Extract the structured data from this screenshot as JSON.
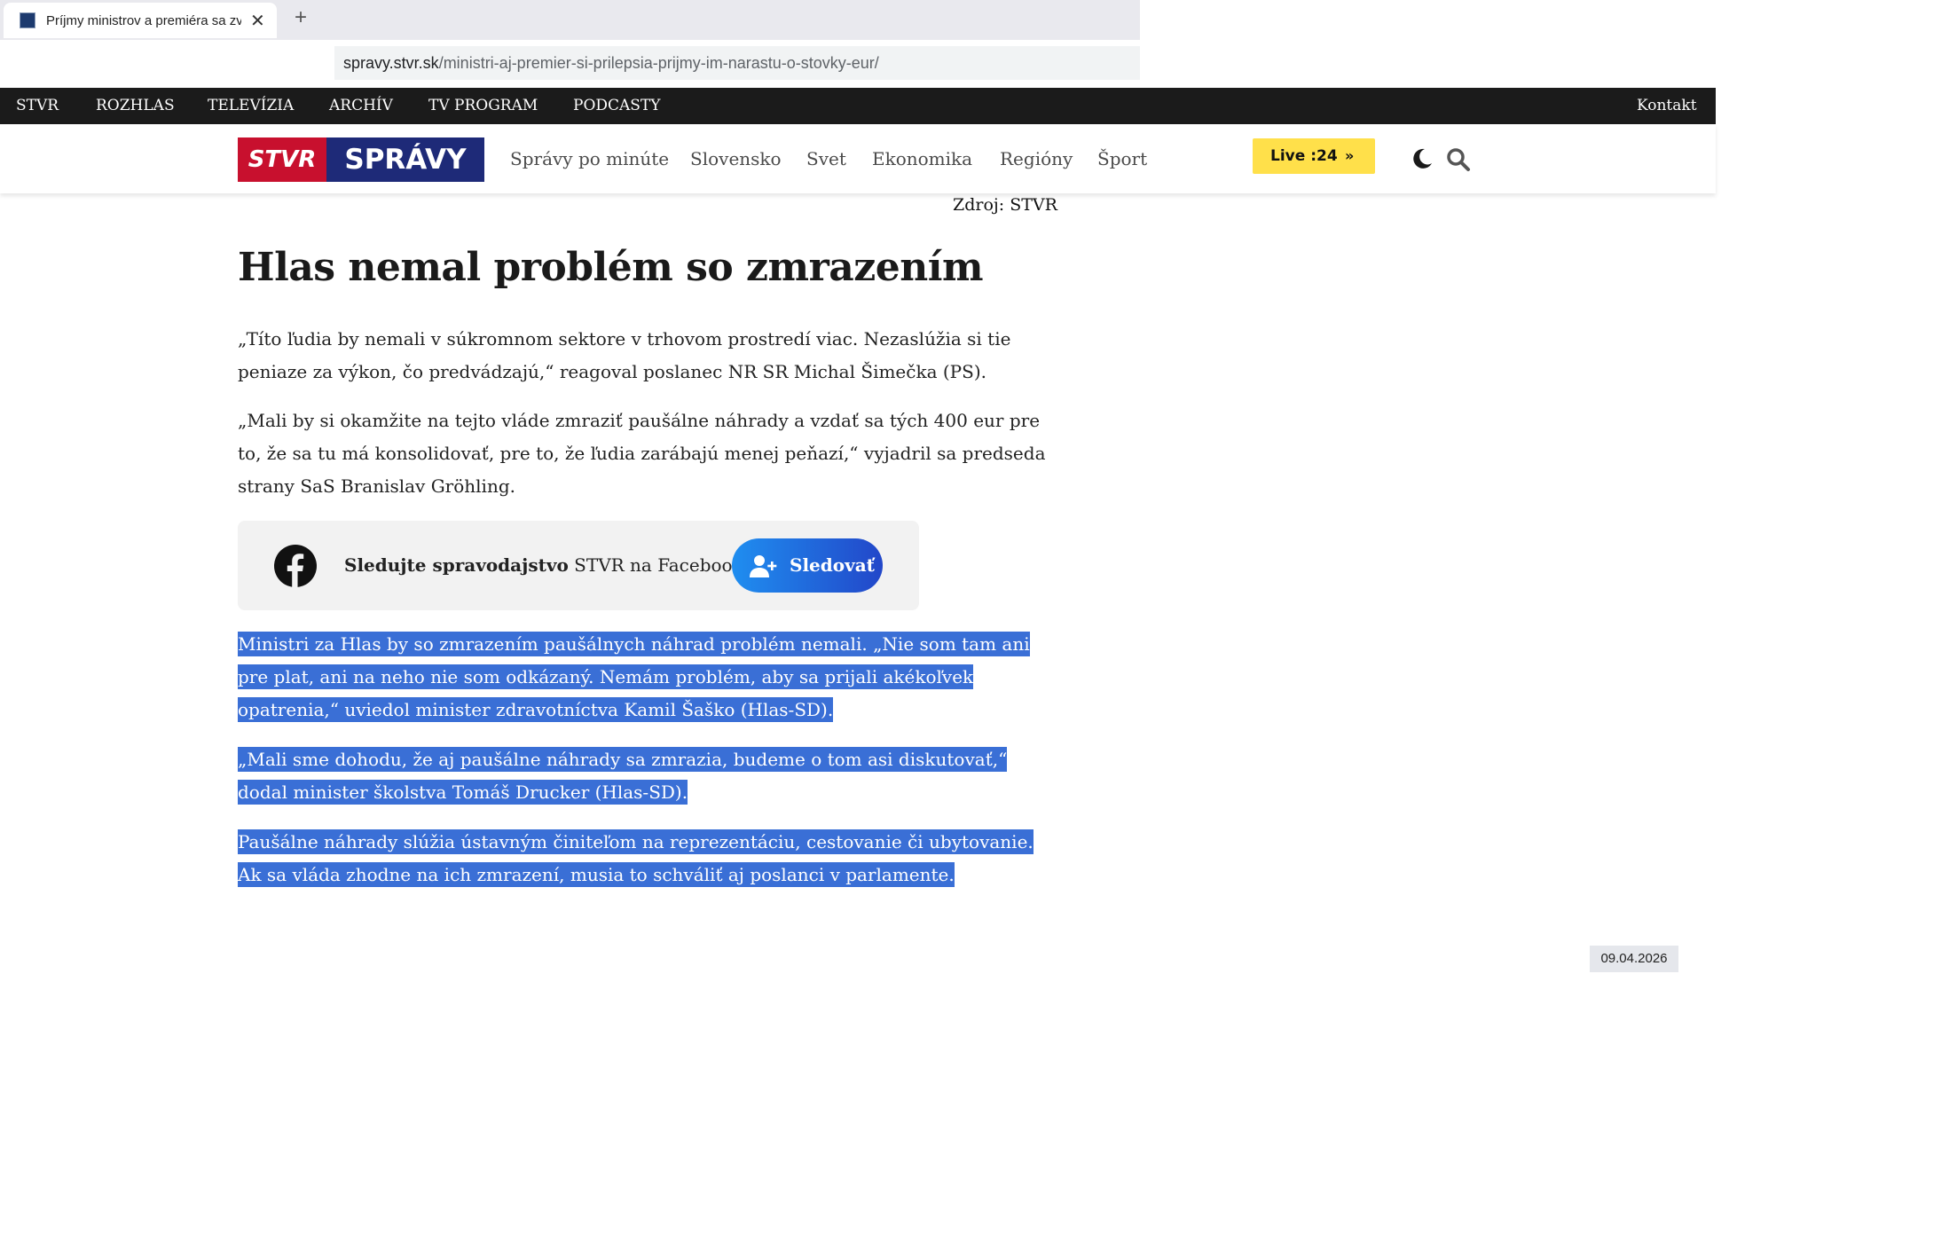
{
  "browser": {
    "tab_title": "Príjmy ministrov a premiéra sa zvýšia",
    "close_symbol": "✕",
    "new_tab_symbol": "+",
    "url_host": "spravy.stvr.sk",
    "url_path": "/ministri-aj-premier-si-prilepsia-prijmy-im-narastu-o-stovky-eur/"
  },
  "topbar": {
    "items": [
      "STVR",
      "ROZHLAS",
      "TELEVÍZIA",
      "ARCHÍV",
      "TV PROGRAM",
      "PODCASTY"
    ],
    "contact": "Kontakt"
  },
  "header": {
    "logo_left": "STVR",
    "logo_right": "SPRÁVY",
    "nav": [
      "Správy po minúte",
      "Slovensko",
      "Svet",
      "Ekonomika",
      "Regióny",
      "Šport"
    ],
    "live_label": "Live :24",
    "live_arrow": "»"
  },
  "article": {
    "source": "Zdroj: STVR",
    "heading": "Hlas nemal problém so zmrazením",
    "p1": "„Títo ľudia by nemali v súkromnom sektore v trhovom prostredí viac. Nezaslúžia si tie peniaze za výkon, čo predvádzajú,“ reagoval poslanec NR SR Michal Šimečka (PS).",
    "p2": "„Mali by si okamžite na tejto vláde zmraziť paušálne náhrady a vzdať sa tých 400 eur pre to, že sa tu má konsolidovať, pre to, že ľudia zarábajú menej peňazí,“ vyjadril sa predseda strany SaS Branislav Gröhling.",
    "fb_bold": "Sledujte spravodajstvo",
    "fb_rest": " STVR na Facebooku",
    "follow_label": "Sledovať",
    "p3": "Ministri za Hlas by so zmrazením paušálnych náhrad problém nemali. „Nie som tam ani pre plat, ani na neho nie som odkázaný. Nemám problém, aby sa prijali akékoľvek opatrenia,“ uviedol minister zdravotníctva Kamil Šaško (Hlas-SD).",
    "p4": "„Mali sme dohodu, že aj paušálne náhrady sa zmrazia, budeme o tom asi diskutovať,“ dodal minister školstva Tomáš Drucker (Hlas-SD).",
    "p5": "Paušálne náhrady slúžia ústavným činiteľom na reprezentáciu, cestovanie či ubytovanie. Ak sa vláda zhodne na ich zmrazení, musia to schváliť aj poslanci v parlamente."
  },
  "taskbar_date": "09.04.2026",
  "colors": {
    "selection": "#3a6fd6",
    "brand_red": "#c8102e",
    "brand_blue": "#1e2a78",
    "live_yellow": "#ffe04a"
  },
  "icons": [
    "favicon-icon",
    "close-icon",
    "moon-icon",
    "search-icon",
    "facebook-icon",
    "add-user-icon"
  ]
}
